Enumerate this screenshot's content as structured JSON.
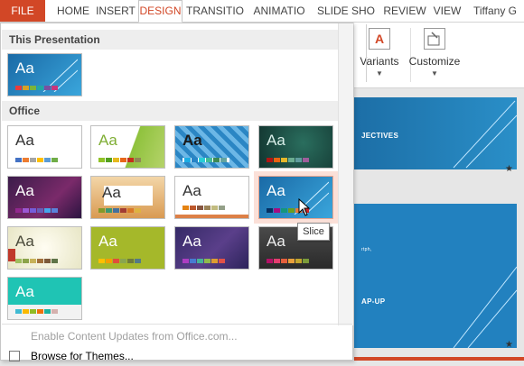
{
  "ribbon_tabs": [
    {
      "label": "FILE"
    },
    {
      "label": "HOME"
    },
    {
      "label": "INSERT"
    },
    {
      "label": "DESIGN"
    },
    {
      "label": "TRANSITIO"
    },
    {
      "label": "ANIMATIO"
    },
    {
      "label": "SLIDE SHO"
    },
    {
      "label": "REVIEW"
    },
    {
      "label": "VIEW"
    },
    {
      "label": "Tiffany G"
    }
  ],
  "ribbon": {
    "variants_label": "Variants",
    "customize_label": "Customize",
    "variants_icon": "variants-icon",
    "customize_icon": "customize-icon"
  },
  "panel": {
    "section_this": "This Presentation",
    "section_office": "Office",
    "tooltip": "Slice",
    "enable_updates": "Enable Content Updates from Office.com...",
    "browse_themes": "Browse for Themes..."
  },
  "themes": [
    {
      "aa": "Aa"
    },
    {
      "aa": "Aa"
    },
    {
      "aa": "Aa"
    },
    {
      "aa": "Aa"
    },
    {
      "aa": "Aa"
    },
    {
      "aa": "Aa"
    },
    {
      "aa": "Aa"
    },
    {
      "aa": "Aa"
    },
    {
      "aa": "Aa"
    },
    {
      "aa": "Aa"
    },
    {
      "aa": "Aa"
    },
    {
      "aa": "Aa"
    },
    {
      "aa": "Aa"
    },
    {
      "aa": "Aa"
    }
  ],
  "slides": {
    "s1_text": "JECTIVES",
    "s2_text": "AP-UP",
    "s2_small": "rtph,"
  },
  "colors": {
    "accent": "#d24726",
    "slice_blue": "#2281bf"
  }
}
